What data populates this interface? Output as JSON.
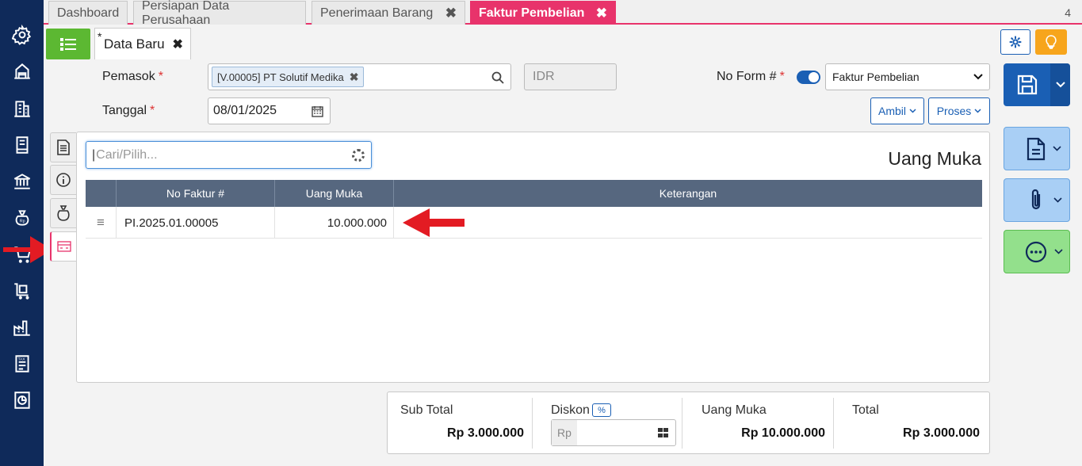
{
  "tabs": [
    {
      "label": "Dashboard",
      "closable": false
    },
    {
      "label": "Persiapan Data Perusahaan",
      "closable": false
    },
    {
      "label": "Penerimaan Barang",
      "closable": true
    },
    {
      "label": "Faktur Pembelian",
      "closable": true,
      "active": true
    }
  ],
  "tab_count": "4",
  "doc_tab": {
    "modified_mark": "*",
    "label": "Data Baru"
  },
  "form": {
    "pemasok_label": "Pemasok",
    "pemasok_value": "[V.00005] PT Solutif Medika",
    "currency": "IDR",
    "tanggal_label": "Tanggal",
    "tanggal_value": "08/01/2025",
    "required_mark": "*",
    "no_form_label": "No Form #",
    "no_form_type": "Faktur Pembelian",
    "ambil_label": "Ambil",
    "proses_label": "Proses"
  },
  "panel": {
    "search_placeholder": "Cari/Pilih...",
    "title": "Uang Muka",
    "columns": [
      "No Faktur #",
      "Uang Muka",
      "Keterangan"
    ],
    "rows": [
      {
        "no_faktur": "PI.2025.01.00005",
        "uang_muka": "10.000.000",
        "keterangan": ""
      }
    ]
  },
  "totals": {
    "sub_total_label": "Sub Total",
    "sub_total_value": "Rp 3.000.000",
    "diskon_label": "Diskon",
    "diskon_unit": "%",
    "diskon_prefix": "Rp",
    "uang_muka_label": "Uang Muka",
    "uang_muka_value": "Rp 10.000.000",
    "total_label": "Total",
    "total_value": "Rp 3.000.000"
  },
  "colors": {
    "sidebar": "#0f2a5a",
    "active_tab": "#e8336b",
    "accent_blue": "#1a5fb4",
    "list_green": "#5cb832",
    "bulb_orange": "#f7a51c",
    "annotation_red": "#e31b23"
  },
  "icons": {
    "sidebar": [
      "gear-icon",
      "warehouse-icon",
      "building-icon",
      "ledger-icon",
      "bank-icon",
      "money-bag-icon",
      "cart-icon",
      "delivery-cart-icon",
      "factory-icon",
      "tax-icon",
      "report-icon"
    ],
    "side_tabs": [
      "document-icon",
      "info-icon",
      "money-bag-icon",
      "advance-payment-icon"
    ],
    "right_actions": [
      "save-icon",
      "file-icon",
      "paperclip-icon",
      "more-icon"
    ]
  }
}
